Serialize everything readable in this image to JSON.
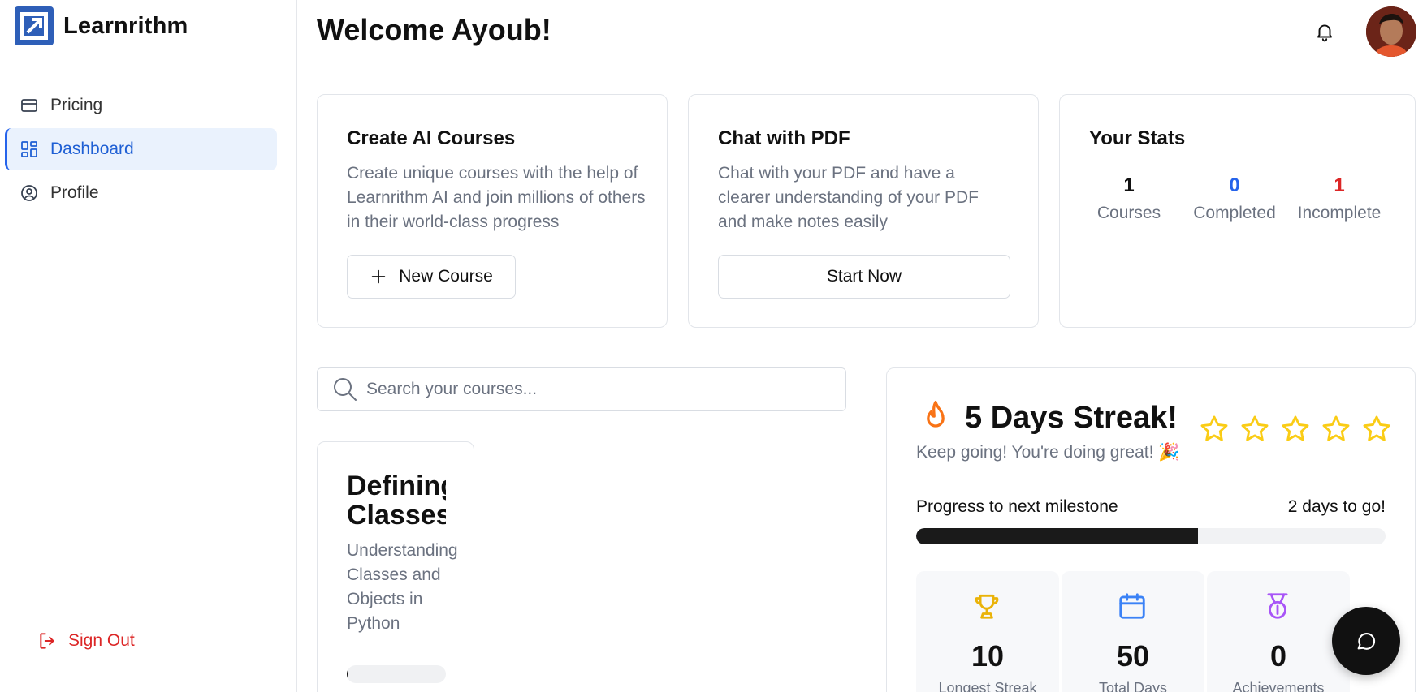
{
  "brand": {
    "name": "Learnrithm"
  },
  "sidebar": {
    "items": [
      {
        "label": "Pricing",
        "icon": "credit-card-icon",
        "active": false
      },
      {
        "label": "Dashboard",
        "icon": "dashboard-grid-icon",
        "active": true
      },
      {
        "label": "Profile",
        "icon": "user-circle-icon",
        "active": false
      }
    ],
    "signout_label": "Sign Out"
  },
  "header": {
    "title": "Welcome Ayoub!"
  },
  "cards": {
    "create": {
      "title": "Create AI Courses",
      "description": "Create unique courses with the help of Learnrithm AI and join millions of others in their world-class progress",
      "button_label": "New Course"
    },
    "pdf": {
      "title": "Chat with PDF",
      "description": "Chat with your PDF and have a clearer understanding of your PDF and make notes easily",
      "button_label": "Start Now"
    },
    "stats": {
      "title": "Your Stats",
      "items": [
        {
          "value": "1",
          "label": "Courses",
          "color": "#111111"
        },
        {
          "value": "0",
          "label": "Completed",
          "color": "#2563eb"
        },
        {
          "value": "1",
          "label": "Incomplete",
          "color": "#dc2626"
        }
      ]
    }
  },
  "search": {
    "placeholder": "Search your courses...",
    "value": ""
  },
  "courses": [
    {
      "title_line1": "Defining",
      "title_line2": "Classes",
      "description": "Understanding Classes and Objects in Python",
      "progress": 0.02
    }
  ],
  "streak": {
    "title": "5 Days Streak!",
    "subtitle": "Keep going! You're doing great! 🎉",
    "stars_count": 5,
    "milestone_label": "Progress to next milestone",
    "milestone_remaining": "2 days to go!",
    "milestone_progress": 0.6,
    "mini_stats": [
      {
        "value": "10",
        "label": "Longest Streak",
        "icon": "trophy-icon",
        "color": "#eab308"
      },
      {
        "value": "50",
        "label": "Total Days",
        "icon": "calendar-icon",
        "color": "#3b82f6"
      },
      {
        "value": "0",
        "label": "Achievements",
        "icon": "medal-icon",
        "color": "#a855f7"
      }
    ]
  },
  "colors": {
    "accent": "#2563eb",
    "danger": "#dc2626",
    "star": "#facc15",
    "flame": "#f97316"
  }
}
